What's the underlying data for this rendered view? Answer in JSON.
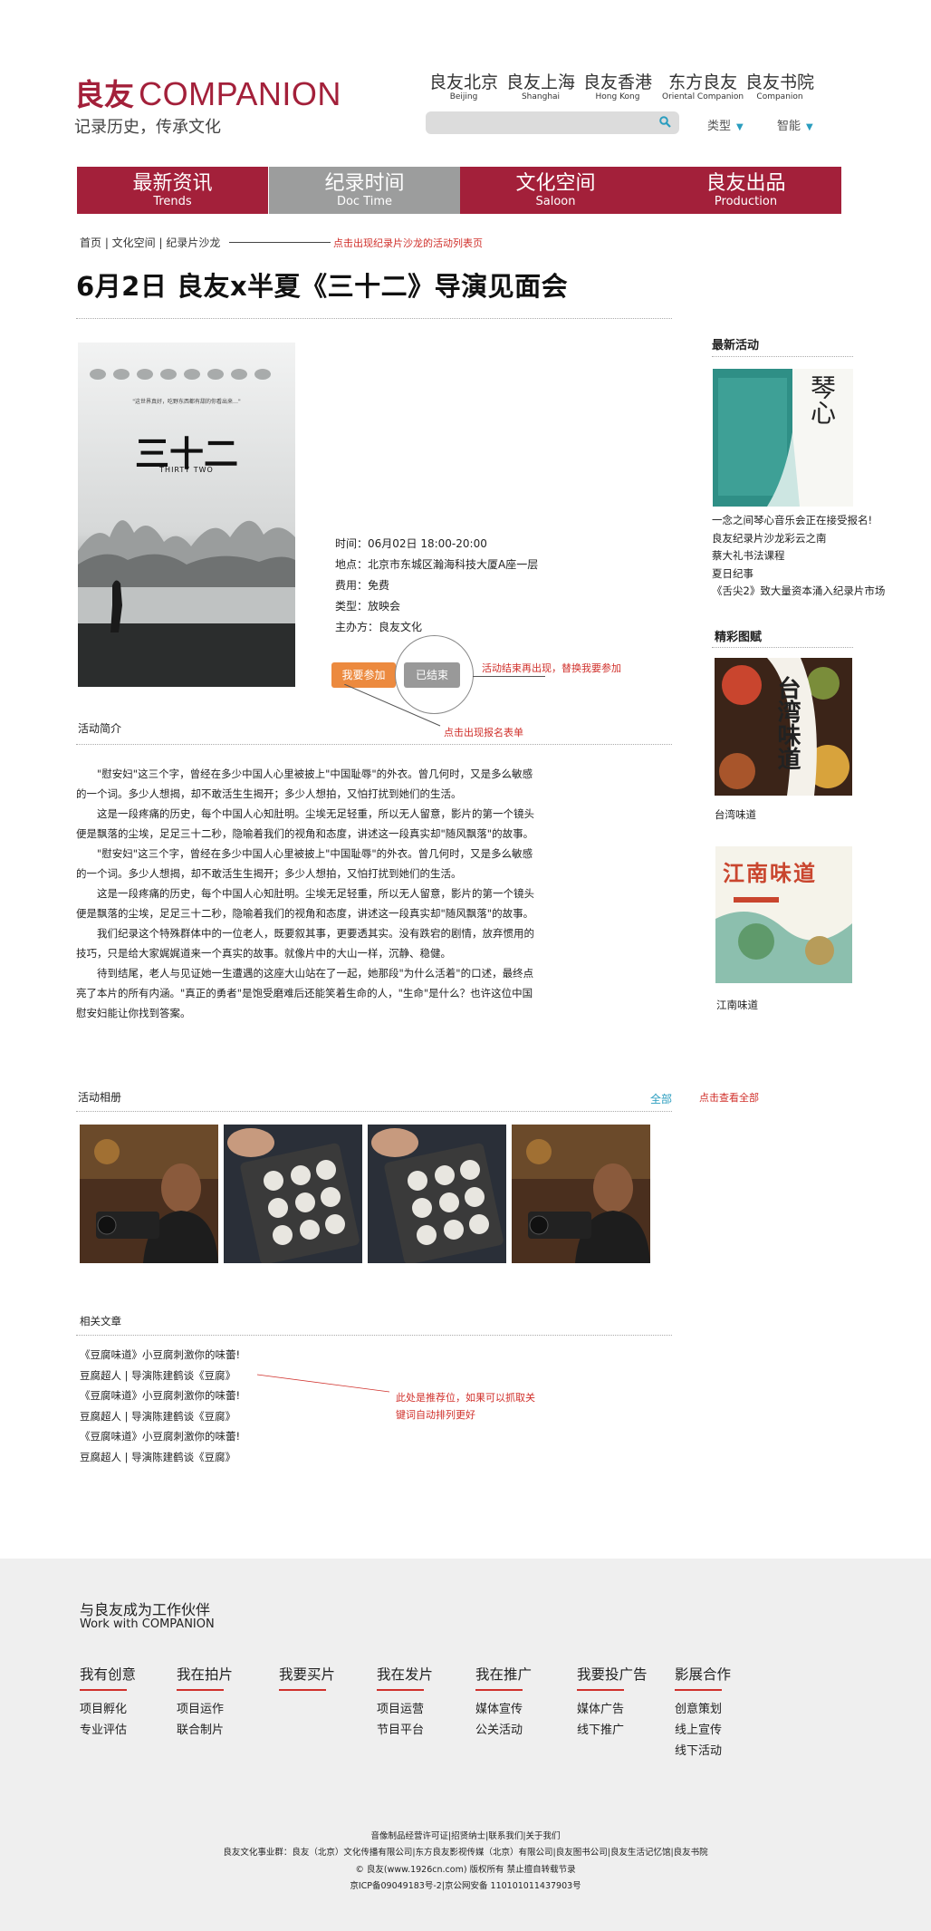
{
  "header": {
    "logo_cn": "良友",
    "logo_en": "COMPANION",
    "slogan": "记录历史，传承文化",
    "branches": [
      {
        "cn": "良友北京",
        "en": "Beijing"
      },
      {
        "cn": "良友上海",
        "en": "Shanghai"
      },
      {
        "cn": "良友香港",
        "en": "Hong Kong"
      },
      {
        "cn": "东方良友",
        "en": "Oriental Companion"
      },
      {
        "cn": "良友书院",
        "en": "Companion"
      }
    ],
    "search_placeholder": "",
    "dropdowns": [
      "类型",
      "智能"
    ]
  },
  "nav": [
    {
      "cn": "最新资讯",
      "en": "Trends"
    },
    {
      "cn": "纪录时间",
      "en": "Doc Time"
    },
    {
      "cn": "文化空间",
      "en": "Saloon"
    },
    {
      "cn": "良友出品",
      "en": "Production"
    }
  ],
  "breadcrumb": {
    "text": "首页 | 文化空间 | 纪录片沙龙",
    "note": "点击出现纪录片沙龙的活动列表页"
  },
  "event": {
    "title": "6月2日 良友x半夏《三十二》导演见面会",
    "poster_title": "三十二",
    "poster_en": "THIRTY TWO",
    "poster_caption": "\"这世界真好，吃野东西都有甜的你看出来…\"",
    "time": "时间：06月02日  18:00-20:00",
    "place": "地点：北京市东城区瀚海科技大厦A座一层",
    "fee": "费用：免费",
    "type": "类型：放映会",
    "host": "主办方：良友文化",
    "join_label": "我要参加",
    "ended_label": "已结束",
    "note_ended": "活动结束再出现，替换我要参加",
    "note_join": "点击出现报名表单"
  },
  "intro": {
    "heading": "活动简介",
    "paragraphs": [
      "\"慰安妇\"这三个字，曾经在多少中国人心里被披上\"中国耻辱\"的外衣。曾几何时，又是多么敏感的一个词。多少人想揭，却不敢活生生揭开；多少人想拍，又怕打扰到她们的生活。",
      "这是一段疼痛的历史，每个中国人心知肚明。尘埃无足轻重，所以无人留意，影片的第一个镜头便是飘落的尘埃，足足三十二秒，隐喻着我们的视角和态度，讲述这一段真实却\"随风飘落\"的故事。",
      "\"慰安妇\"这三个字，曾经在多少中国人心里被披上\"中国耻辱\"的外衣。曾几何时，又是多么敏感的一个词。多少人想揭，却不敢活生生揭开；多少人想拍，又怕打扰到她们的生活。",
      "这是一段疼痛的历史，每个中国人心知肚明。尘埃无足轻重，所以无人留意，影片的第一个镜头便是飘落的尘埃，足足三十二秒，隐喻着我们的视角和态度，讲述这一段真实却\"随风飘落\"的故事。",
      "我们纪录这个特殊群体中的一位老人，既要叙其事，更要透其实。没有跌宕的剧情，放弃惯用的技巧，只是给大家娓娓道来一个真实的故事。就像片中的大山一样，沉静、稳健。",
      "待到结尾，老人与见证她一生遭遇的这座大山站在了一起，她那段\"为什么活着\"的口述，最终点亮了本片的所有内涵。\"真正的勇者\"是饱受磨难后还能笑着生命的人，\"生命\"是什么？也许这位中国慰安妇能让你找到答案。"
    ]
  },
  "album": {
    "heading": "活动相册",
    "all_label": "全部",
    "note": "点击查看全部"
  },
  "related": {
    "heading": "相关文章",
    "items": [
      "《豆腐味道》小豆腐刺激你的味蕾!",
      "豆腐超人 | 导演陈建鹤谈《豆腐》",
      "《豆腐味道》小豆腐刺激你的味蕾!",
      "豆腐超人 | 导演陈建鹤谈《豆腐》",
      "《豆腐味道》小豆腐刺激你的味蕾!",
      "豆腐超人 | 导演陈建鹤谈《豆腐》"
    ],
    "note": "此处是推荐位，如果可以抓取关键词自动排列更好"
  },
  "sidebar": {
    "latest_heading": "最新活动",
    "latest_items": [
      "一念之间琴心音乐会正在接受报名!",
      "良友纪录片沙龙彩云之南",
      "蔡大礼书法课程",
      "夏日纪事",
      "《舌尖2》致大量资本涌入纪录片市场"
    ],
    "qin_title": "琴心",
    "galleries_heading": "精彩图赋",
    "gallery1_label": "台湾味道",
    "gallery1_art": "台湾味道",
    "gallery2_label": "江南味道",
    "gallery2_art": "江南味道"
  },
  "footer": {
    "tagline_cn": "与良友成为工作伙伴",
    "tagline_en": "Work with COMPANION",
    "columns": [
      {
        "title": "我有创意",
        "items": [
          "项目孵化",
          "专业评估"
        ]
      },
      {
        "title": "我在拍片",
        "items": [
          "项目运作",
          "联合制片"
        ]
      },
      {
        "title": "我要买片",
        "items": []
      },
      {
        "title": "我在发片",
        "items": [
          "项目运营",
          "节目平台"
        ]
      },
      {
        "title": "我在推广",
        "items": [
          "媒体宣传",
          "公关活动"
        ]
      },
      {
        "title": "我要投广告",
        "items": [
          "媒体广告",
          "线下推广"
        ]
      },
      {
        "title": "影展合作",
        "items": [
          "创意策划",
          "线上宣传",
          "线下活动"
        ]
      }
    ],
    "lines": [
      "音像制品经营许可证|招贤纳士|联系我们|关于我们",
      "良友文化事业群：良友（北京）文化传播有限公司|东方良友影视传媒（北京）有限公司|良友图书公司|良友生活记忆馆|良友书院",
      "© 良友(www.1926cn.com) 版权所有 禁止擅自转载节录",
      "京ICP备09049183号-2|京公网安备 110101011437903号"
    ]
  },
  "colors": {
    "brand_red": "#a3203a",
    "nav_grey": "#9c9d9d",
    "join_orange": "#ec8a3f",
    "note_red": "#d0302b",
    "accent_teal": "#2a9dbf"
  }
}
